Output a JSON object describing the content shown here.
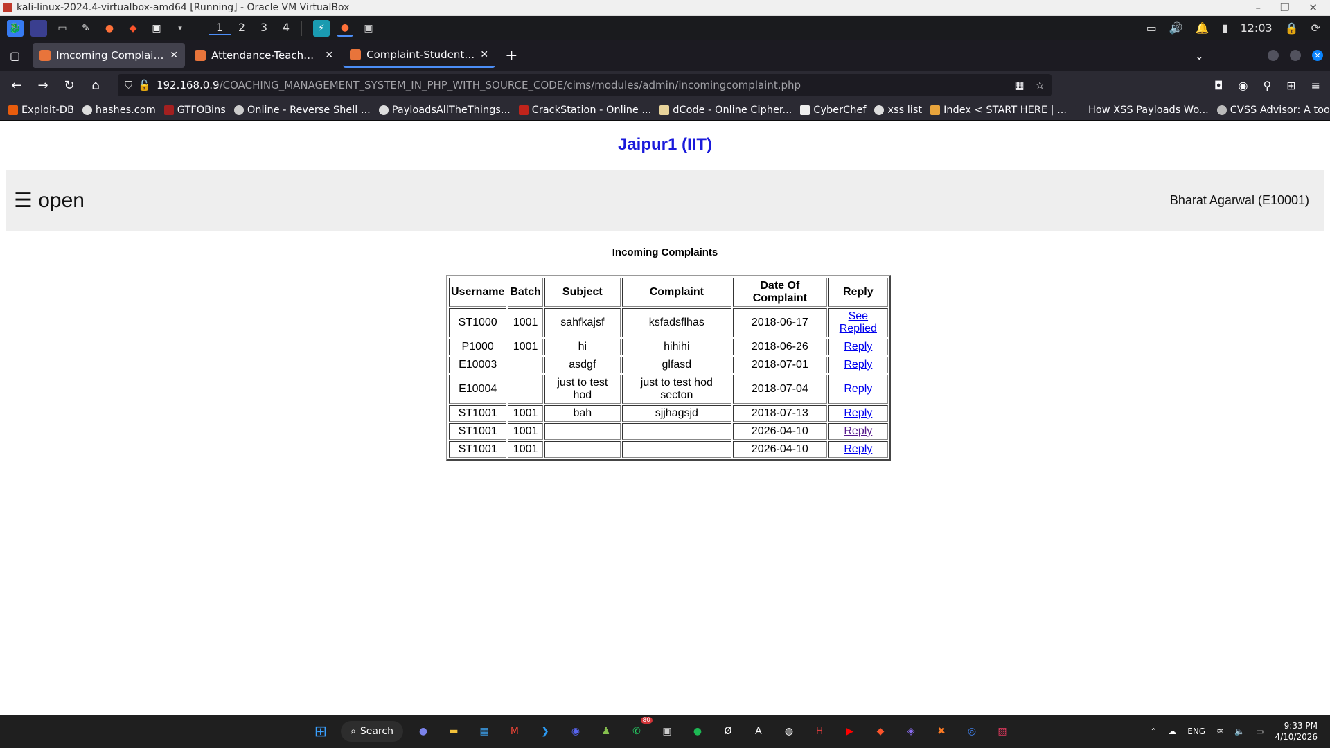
{
  "vbox": {
    "title": "kali-linux-2024.4-virtualbox-amd64 [Running] - Oracle VM VirtualBox",
    "controls": [
      "–",
      "❐",
      "✕"
    ]
  },
  "kali_panel": {
    "workspaces": [
      "1",
      "2",
      "3",
      "4"
    ],
    "clock": "12:03"
  },
  "tabs": [
    {
      "title": "Imcoming Complaints-CIMS",
      "active": true
    },
    {
      "title": "Attendance-Teachers-CIMS",
      "active": false
    },
    {
      "title": "Complaint-Students-CIMS",
      "active": false
    }
  ],
  "nav": {
    "url_host": "192.168.0.9",
    "url_path": "/COACHING_MANAGEMENT_SYSTEM_IN_PHP_WITH_SOURCE_CODE/cims/modules/admin/incomingcomplaint.php"
  },
  "bookmarks": [
    "Exploit-DB",
    "hashes.com",
    "GTFOBins",
    "Online - Reverse Shell ...",
    "PayloadsAllTheThings...",
    "CrackStation - Online ...",
    "dCode - Online Cipher...",
    "CyberChef",
    "xss list",
    "Index < START HERE | ...",
    "How XSS Payloads Wo...",
    "CVSS Advisor: A tool t..."
  ],
  "page": {
    "site_title": "Jaipur1 (IIT)",
    "open_label": "☰ open",
    "user_label": "Bharat Agarwal (E10001)",
    "section_title": "Incoming Complaints",
    "table": {
      "headers": [
        "Username",
        "Batch",
        "Subject",
        "Complaint",
        "Date Of Complaint",
        "Reply"
      ],
      "rows": [
        {
          "username": "ST1000",
          "batch": "1001",
          "subject": "sahfkajsf",
          "complaint": "ksfadsflhas",
          "date": "2018-06-17",
          "reply": "See Replied"
        },
        {
          "username": "P1000",
          "batch": "1001",
          "subject": "hi",
          "complaint": "hihihi",
          "date": "2018-06-26",
          "reply": "Reply"
        },
        {
          "username": "E10003",
          "batch": "",
          "subject": "asdgf",
          "complaint": "glfasd",
          "date": "2018-07-01",
          "reply": "Reply"
        },
        {
          "username": "E10004",
          "batch": "",
          "subject": "just to test hod",
          "complaint": "just to test hod secton",
          "date": "2018-07-04",
          "reply": "Reply"
        },
        {
          "username": "ST1001",
          "batch": "1001",
          "subject": "bah",
          "complaint": "sjjhagsjd",
          "date": "2018-07-13",
          "reply": "Reply"
        },
        {
          "username": "ST1001",
          "batch": "1001",
          "subject": "",
          "complaint": "",
          "date": "2026-04-10",
          "reply": "Reply"
        },
        {
          "username": "ST1001",
          "batch": "1001",
          "subject": "",
          "complaint": "",
          "date": "2026-04-10",
          "reply": "Reply"
        }
      ]
    }
  },
  "taskbar": {
    "search_label": "Search",
    "whatsapp_badge": "80",
    "lang": "ENG",
    "time": "9:33 PM",
    "date": "4/10/2026"
  },
  "colors": {
    "site_title": "#1a1adb",
    "link": "#0000ee",
    "nav_bg": "#eeeeee"
  }
}
